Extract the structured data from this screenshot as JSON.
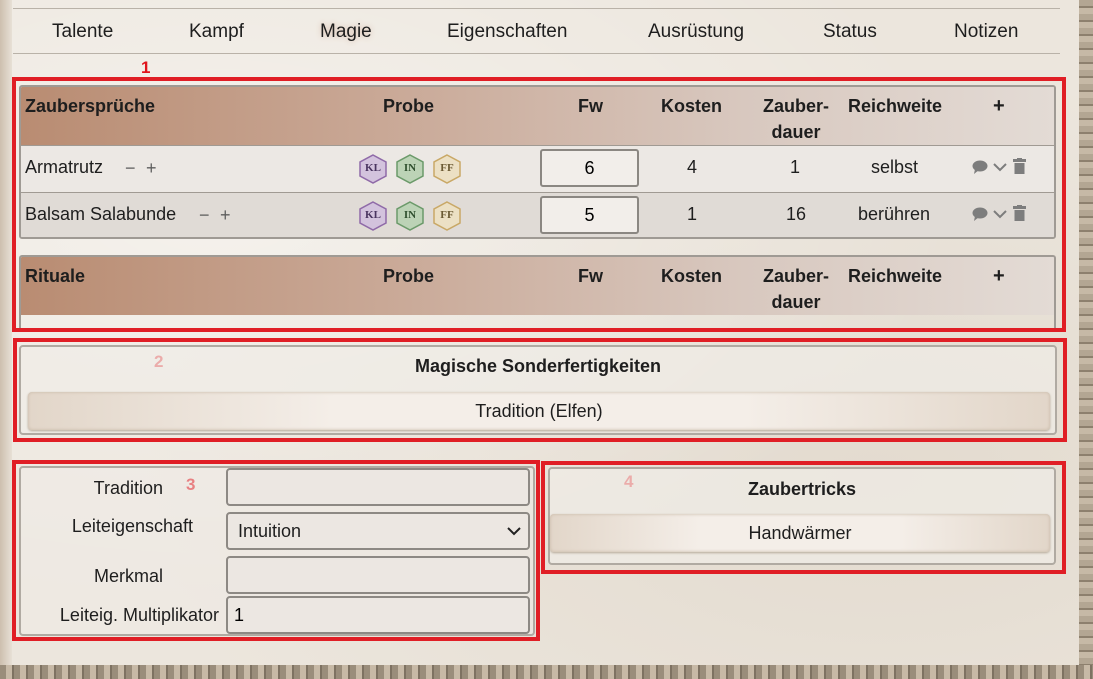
{
  "tabs": [
    {
      "label": "Talente"
    },
    {
      "label": "Kampf"
    },
    {
      "label": "Magie"
    },
    {
      "label": "Eigenschaften"
    },
    {
      "label": "Ausrüstung"
    },
    {
      "label": "Status"
    },
    {
      "label": "Notizen"
    }
  ],
  "active_tab": "Magie",
  "annotations": [
    "1",
    "2",
    "3",
    "4"
  ],
  "colors": {
    "annotation_red": "#e01e25",
    "kl": "#8f6aa8",
    "in": "#6b9a6a",
    "ff": "#c9a866"
  },
  "spells": {
    "header": {
      "name": "Zaubersprüche",
      "probe": "Probe",
      "fw": "Fw",
      "kosten": "Kosten",
      "dauer_1": "Zauber-",
      "dauer_2": "dauer",
      "reichweite": "Reichweite",
      "add": "+"
    },
    "rows": [
      {
        "name": "Armatrutz",
        "minus": "−",
        "plus": "+",
        "probe": [
          "KL",
          "IN",
          "FF"
        ],
        "fw": "6",
        "kosten": "4",
        "dauer": "1",
        "reichweite": "selbst"
      },
      {
        "name": "Balsam Salabunde",
        "minus": "−",
        "plus": "+",
        "probe": [
          "KL",
          "IN",
          "FF"
        ],
        "fw": "5",
        "kosten": "1",
        "dauer": "16",
        "reichweite": "berühren"
      }
    ]
  },
  "rituals": {
    "header": {
      "name": "Rituale",
      "probe": "Probe",
      "fw": "Fw",
      "kosten": "Kosten",
      "dauer_1": "Zauber-",
      "dauer_2": "dauer",
      "reichweite": "Reichweite",
      "add": "+"
    }
  },
  "special_abilities": {
    "title": "Magische Sonderfertigkeiten",
    "items": [
      "Tradition (Elfen)"
    ]
  },
  "tradition_form": {
    "tradition_label": "Tradition",
    "tradition_value": "",
    "leiteigenschaft_label": "Leiteigenschaft",
    "leiteigenschaft_value": "Intuition",
    "merkmal_label": "Merkmal",
    "merkmal_value": "",
    "multiplikator_label": "Leiteig. Multiplikator",
    "multiplikator_value": "1"
  },
  "tricks": {
    "title": "Zaubertricks",
    "items": [
      "Handwärmer"
    ]
  }
}
